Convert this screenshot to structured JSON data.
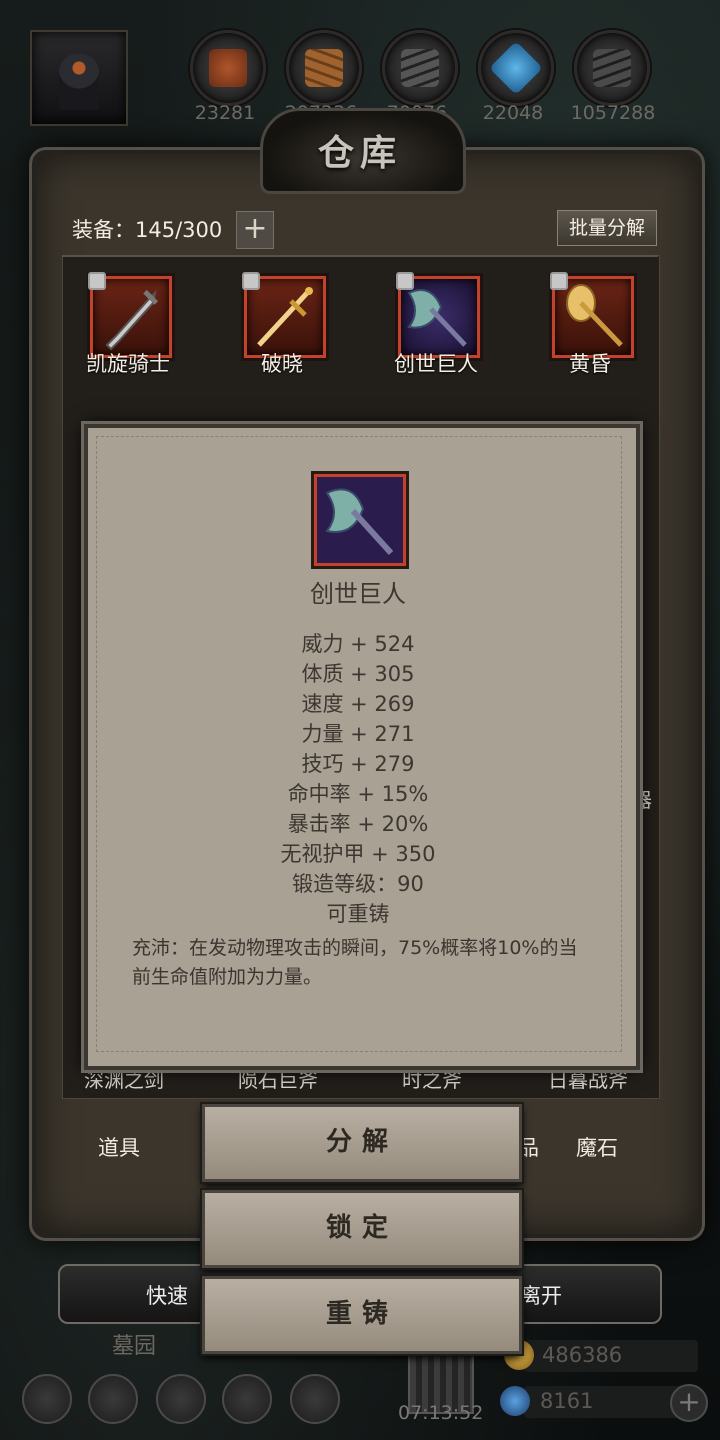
{
  "resources": {
    "r1": "23281",
    "r2": "297236",
    "r3": "70076",
    "r4": "22048",
    "r5": "1057288"
  },
  "warehouse": {
    "title": "仓库",
    "equip_count": "装备：145/300",
    "plus": "+",
    "batch_label": "批量分解"
  },
  "items": [
    {
      "name": "凯旋骑士",
      "icon": "greatsword-icon",
      "locked": true
    },
    {
      "name": "破晓",
      "icon": "golden-sword-icon",
      "locked": true
    },
    {
      "name": "创世巨人",
      "icon": "purple-axe-icon",
      "locked": true
    },
    {
      "name": "黄昏",
      "icon": "golden-axe-icon",
      "locked": true
    }
  ],
  "hidden_row": {
    "n1": "深渊之剑",
    "n2": "陨石巨斧",
    "n3": "时之斧",
    "n4": "日暮战斧"
  },
  "side_fragment": "器",
  "tabs": {
    "left": "道具",
    "mid_fragment": "品",
    "right": "魔石"
  },
  "detail": {
    "name": "创世巨人",
    "stats": [
      "威力 + 524",
      "体质 + 305",
      "速度 + 269",
      "力量 + 271",
      "技巧 + 279",
      "命中率 + 15%",
      "暴击率 + 20%",
      "无视护甲 + 350",
      "锻造等级：90",
      "可重铸"
    ],
    "description": "充沛：在发动物理攻击的瞬间，75%概率将10%的当前生命值附加为力量。"
  },
  "actions": {
    "decompose": "分解",
    "lock": "锁定",
    "reforge": "重铸"
  },
  "bottom": {
    "quick_fragment": "快速",
    "leave_fragment": "离开",
    "place": "墓园",
    "clock": "07:13:52",
    "gold": "486386",
    "gems": "8161",
    "add": "+"
  },
  "colors": {
    "slot_border": "#c2432c",
    "popup_bg": "#aaa195",
    "panel_bg": "#3b352c"
  }
}
